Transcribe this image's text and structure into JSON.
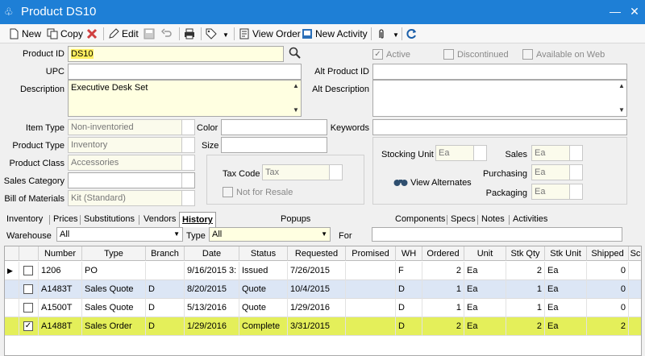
{
  "window": {
    "title": "Product DS10"
  },
  "toolbar": {
    "new": "New",
    "copy": "Copy",
    "edit": "Edit",
    "view_order": "View Order",
    "new_activity": "New Activity"
  },
  "form": {
    "product_id_label": "Product ID",
    "product_id": "DS10",
    "upc_label": "UPC",
    "upc": "",
    "description_label": "Description",
    "description": "Executive Desk Set",
    "item_type_label": "Item Type",
    "item_type": "Non-inventoried",
    "product_type_label": "Product Type",
    "product_type": "Inventory",
    "product_class_label": "Product Class",
    "product_class": "Accessories",
    "sales_category_label": "Sales Category",
    "sales_category": "",
    "bom_label": "Bill of Materials",
    "bom": "Kit (Standard)",
    "color_label": "Color",
    "color": "",
    "size_label": "Size",
    "size": "",
    "tax_code_label": "Tax Code",
    "tax_code": "Tax",
    "not_for_resale_label": "Not for Resale",
    "active_label": "Active",
    "discontinued_label": "Discontinued",
    "available_web_label": "Available on Web",
    "alt_product_id_label": "Alt Product ID",
    "alt_product_id": "",
    "alt_description_label": "Alt Description",
    "alt_description": "",
    "keywords_label": "Keywords",
    "keywords": "",
    "stocking_unit_label": "Stocking Unit",
    "stocking_unit": "Ea",
    "sales_label": "Sales",
    "sales": "Ea",
    "purchasing_label": "Purchasing",
    "purchasing": "Ea",
    "packaging_label": "Packaging",
    "packaging": "Ea",
    "view_alternates": "View Alternates"
  },
  "tabs": [
    "Inventory",
    "Prices",
    "Substitutions",
    "Vendors",
    "History",
    "Popups",
    "Components",
    "Specs",
    "Notes",
    "Activities"
  ],
  "filters": {
    "warehouse_label": "Warehouse",
    "warehouse": "All",
    "type_label": "Type",
    "type": "All",
    "for_label": "For",
    "for": ""
  },
  "grid": {
    "columns": [
      "Number",
      "Type",
      "Branch",
      "Date",
      "Status",
      "Requested",
      "Promised",
      "WH",
      "Ordered",
      "Unit",
      "Stk Qty",
      "Stk Unit",
      "Shipped",
      "Sc"
    ],
    "rows": [
      {
        "checked": false,
        "current": true,
        "number": "1206",
        "type": "PO",
        "branch": "",
        "date": "9/16/2015 3:",
        "status": "Issued",
        "requested": "7/26/2015",
        "promised": "",
        "wh": "F",
        "ordered": "2",
        "unit": "Ea",
        "stk_qty": "2",
        "stk_unit": "Ea",
        "shipped": "0"
      },
      {
        "checked": false,
        "current": false,
        "number": "A1483T",
        "type": "Sales Quote",
        "branch": "D",
        "date": "8/20/2015",
        "status": "Quote",
        "requested": "10/4/2015",
        "promised": "",
        "wh": "D",
        "ordered": "1",
        "unit": "Ea",
        "stk_qty": "1",
        "stk_unit": "Ea",
        "shipped": "0"
      },
      {
        "checked": false,
        "current": false,
        "number": "A1500T",
        "type": "Sales Quote",
        "branch": "D",
        "date": "5/13/2016",
        "status": "Quote",
        "requested": "1/29/2016",
        "promised": "",
        "wh": "D",
        "ordered": "1",
        "unit": "Ea",
        "stk_qty": "1",
        "stk_unit": "Ea",
        "shipped": "0"
      },
      {
        "checked": true,
        "current": false,
        "number": "A1488T",
        "type": "Sales Order",
        "branch": "D",
        "date": "1/29/2016",
        "status": "Complete",
        "requested": "3/31/2015",
        "promised": "",
        "wh": "D",
        "ordered": "2",
        "unit": "Ea",
        "stk_qty": "2",
        "stk_unit": "Ea",
        "shipped": "2"
      }
    ]
  },
  "colors": {
    "titlebar": "#1e7fd6",
    "highlight_row": "#e4ef5a",
    "alt_row": "#dce6f5",
    "field_yellow": "#ffffe1"
  }
}
